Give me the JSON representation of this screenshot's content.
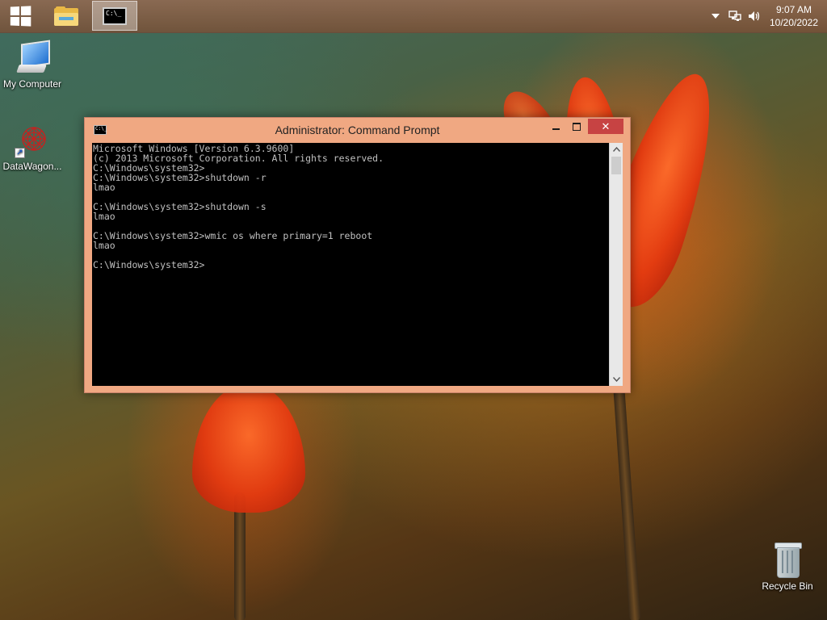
{
  "taskbar": {
    "start_icon": "windows-logo-icon",
    "apps": [
      {
        "name": "File Explorer",
        "icon": "folder-icon"
      },
      {
        "name": "Command Prompt",
        "icon": "cmd-icon",
        "active": true
      }
    ],
    "tray": {
      "icons": [
        "chevron-up-icon",
        "network-icon",
        "volume-icon"
      ],
      "time": "9:07 AM",
      "date": "10/20/2022"
    }
  },
  "desktop_icons": [
    {
      "label": "My Computer",
      "icon": "computer-icon"
    },
    {
      "label": "DataWagon...",
      "icon": "datawagon-icon",
      "shortcut": true
    },
    {
      "label": "Recycle Bin",
      "icon": "recycle-bin-icon"
    }
  ],
  "cmd_window": {
    "title": "Administrator: Command Prompt",
    "icon_text": "C:\\_",
    "controls": {
      "minimize": "minimize-icon",
      "maximize": "maximize-icon",
      "close": "✕"
    },
    "console_lines": [
      "Microsoft Windows [Version 6.3.9600]",
      "(c) 2013 Microsoft Corporation. All rights reserved.",
      "C:\\Windows\\system32>",
      "C:\\Windows\\system32>shutdown -r",
      "lmao",
      "",
      "C:\\Windows\\system32>shutdown -s",
      "lmao",
      "",
      "C:\\Windows\\system32>wmic os where primary=1 reboot",
      "lmao",
      "",
      "C:\\Windows\\system32>"
    ]
  },
  "colors": {
    "window_frame": "#f0a882",
    "close_button": "#c74343",
    "console_bg": "#000000",
    "console_fg": "#c0c0c0"
  }
}
